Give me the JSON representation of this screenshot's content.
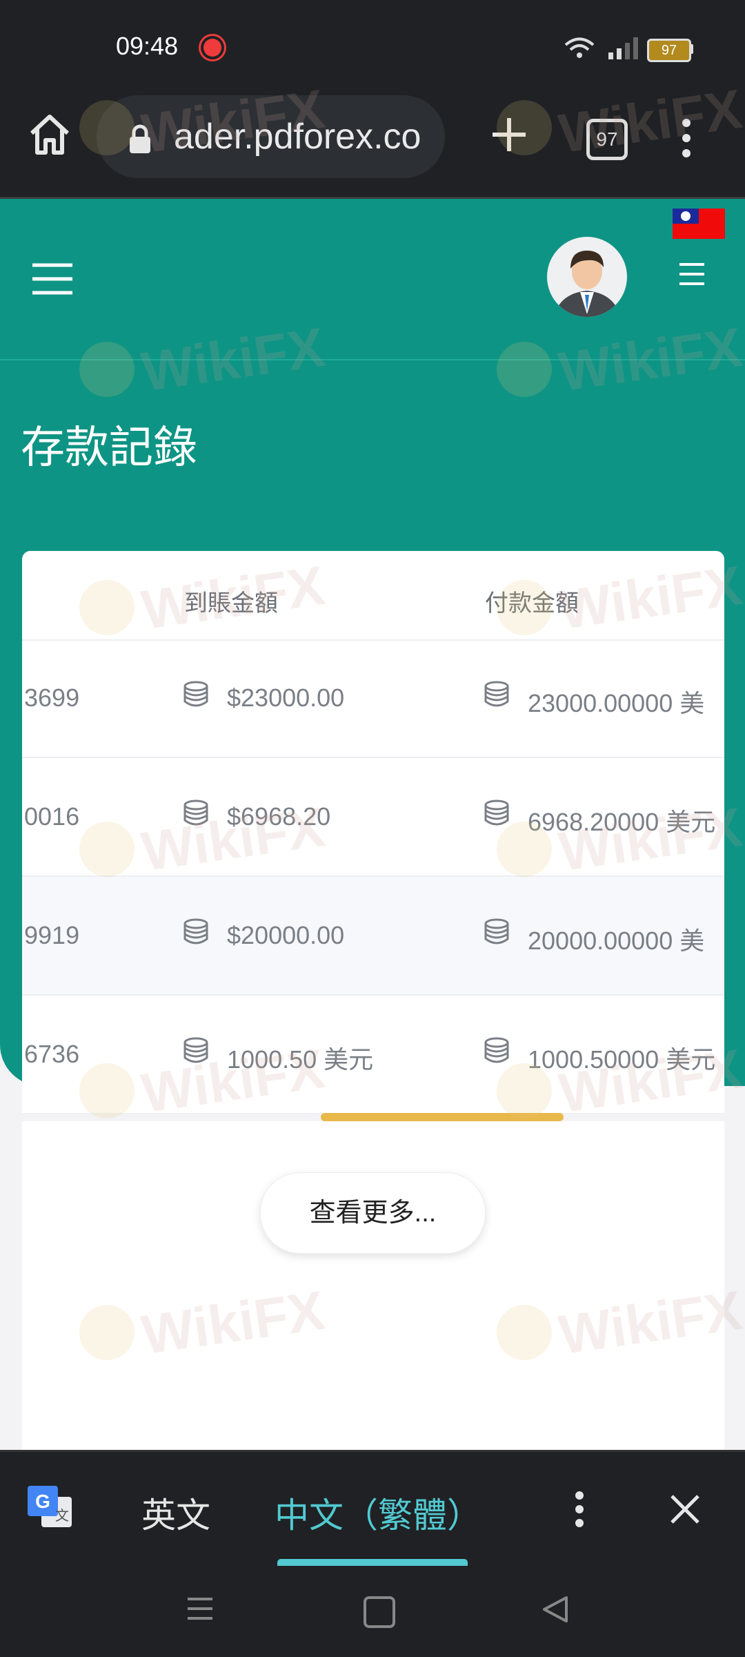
{
  "status_bar": {
    "time": "09:48",
    "battery": "97"
  },
  "browser": {
    "url": "ader.pdforex.co",
    "tab_count": "97"
  },
  "page": {
    "title": "存款記錄"
  },
  "table": {
    "columns": [
      "到賬金額",
      "付款金額"
    ],
    "rows": [
      {
        "id": "3699",
        "received": "$23000.00",
        "paid": "23000.00000 美"
      },
      {
        "id": "0016",
        "received": "$6968.20",
        "paid": "6968.20000 美元"
      },
      {
        "id": "9919",
        "received": "$20000.00",
        "paid": "20000.00000 美"
      },
      {
        "id": "6736",
        "received": "1000.50 美元",
        "paid": "1000.50000 美元"
      }
    ]
  },
  "view_more": "查看更多...",
  "translate_bar": {
    "source_lang": "英文",
    "target_lang": "中文（繁體）"
  },
  "watermark": "WikiFX",
  "colors": {
    "teal": "#0e9484",
    "accent_yellow": "#e9b84b",
    "translate_active": "#52c9d1"
  }
}
